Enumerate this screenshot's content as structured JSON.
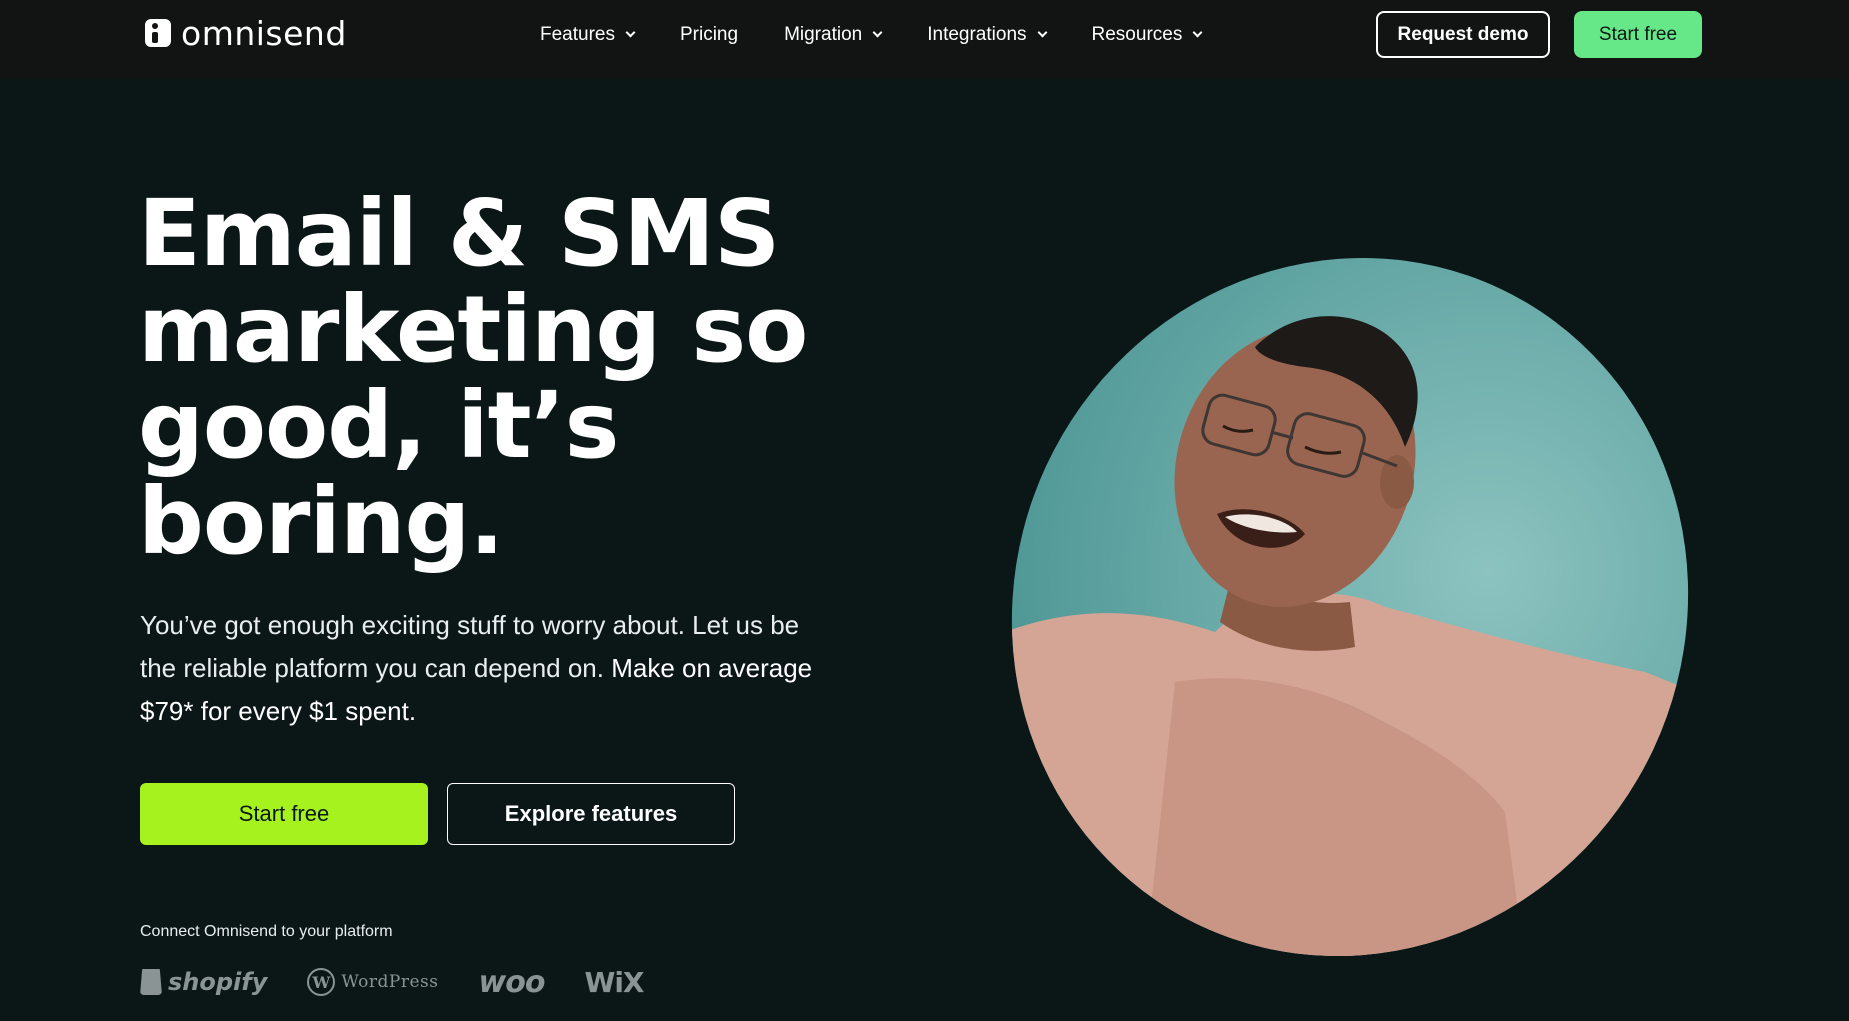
{
  "nav": {
    "logo_text": "omnisend",
    "links": [
      {
        "label": "Features",
        "has_dropdown": true
      },
      {
        "label": "Pricing",
        "has_dropdown": false
      },
      {
        "label": "Migration",
        "has_dropdown": true
      },
      {
        "label": "Integrations",
        "has_dropdown": true
      },
      {
        "label": "Resources",
        "has_dropdown": true
      }
    ],
    "request_demo_label": "Request demo",
    "start_free_label": "Start free"
  },
  "hero": {
    "headline_lines": [
      "Email & SMS",
      "marketing so",
      "good, it’s",
      "boring."
    ],
    "sub_text": "You’ve got enough exciting stuff to worry about. Let us be the reliable platform you can depend on.",
    "sub_text_strong": "Make on average $79* for every $1 spent.",
    "start_free_label": "Start free",
    "explore_label": "Explore features",
    "connect_label": "Connect Omnisend to your platform",
    "platforms": [
      "shopify",
      "WordPress",
      "woo",
      "WiX"
    ]
  },
  "colors": {
    "page_bg": "#0b1717",
    "nav_bg": "#121414",
    "nav_cta": "#67e888",
    "hero_cta": "#a6f21e",
    "image_bg": "#5fa6a4",
    "sweater": "#d4a595"
  },
  "icons": [
    "omnisend-logo-icon",
    "chevron-down-icon",
    "shopify-logo-icon",
    "wordpress-logo-icon"
  ]
}
